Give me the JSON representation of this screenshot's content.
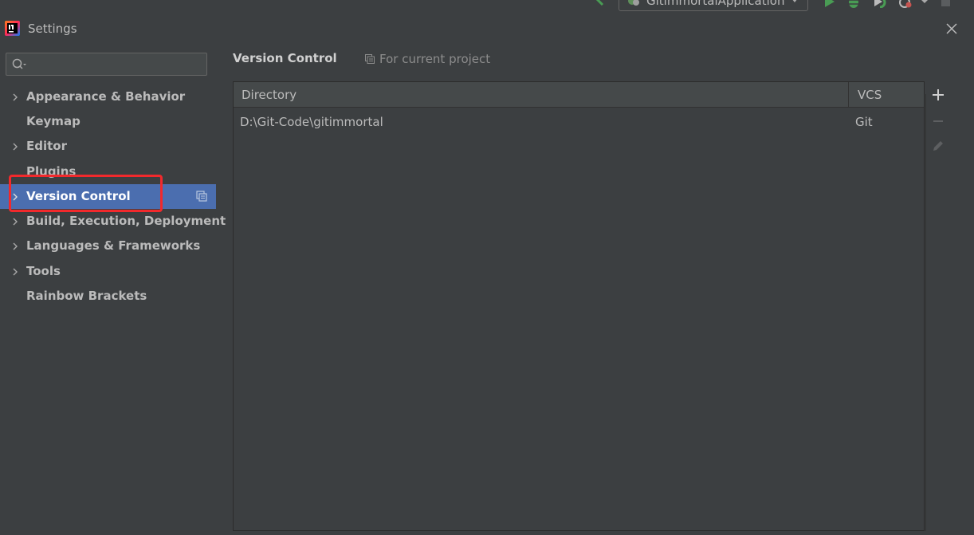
{
  "toolbar": {
    "run_config_label": "GitimmortalApplication",
    "icons": [
      "hammer-icon",
      "run-config-icon",
      "run-icon",
      "debug-icon",
      "coverage-icon",
      "profile-icon",
      "stop-icon"
    ]
  },
  "window": {
    "title": "Settings"
  },
  "search": {
    "value": "",
    "placeholder": ""
  },
  "sidebar": {
    "items": [
      {
        "label": "Appearance & Behavior",
        "expandable": true
      },
      {
        "label": "Keymap",
        "expandable": false
      },
      {
        "label": "Editor",
        "expandable": true
      },
      {
        "label": "Plugins",
        "expandable": false
      },
      {
        "label": "Version Control",
        "expandable": true,
        "selected": true
      },
      {
        "label": "Build, Execution, Deployment",
        "expandable": true
      },
      {
        "label": "Languages & Frameworks",
        "expandable": true
      },
      {
        "label": "Tools",
        "expandable": true
      },
      {
        "label": "Rainbow Brackets",
        "expandable": false
      }
    ]
  },
  "main": {
    "title": "Version Control",
    "scope_label": "For current project",
    "table": {
      "columns": [
        "Directory",
        "VCS"
      ],
      "rows": [
        {
          "directory": "D:\\Git-Code\\gitimmortal",
          "vcs": "Git"
        }
      ]
    },
    "actions": [
      "add-icon",
      "remove-icon",
      "edit-icon"
    ]
  },
  "colors": {
    "background": "#3c3f41",
    "selection": "#4b6eaf",
    "highlight_annotation": "#f2292c",
    "run_green": "#499c54"
  }
}
